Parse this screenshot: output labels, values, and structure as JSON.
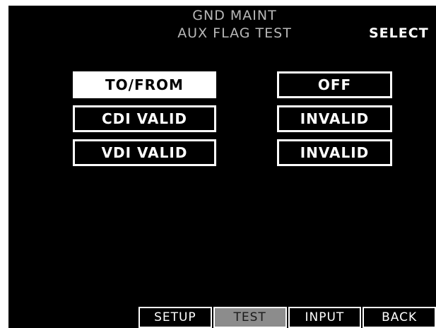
{
  "header": {
    "line1": "GND MAINT",
    "line2": "AUX FLAG TEST",
    "select_label": "SELECT"
  },
  "flags": [
    {
      "name": "TO/FROM",
      "value": "OFF",
      "selected": true
    },
    {
      "name": "CDI VALID",
      "value": "INVALID",
      "selected": false
    },
    {
      "name": "VDI VALID",
      "value": "INVALID",
      "selected": false
    }
  ],
  "softkeys": [
    {
      "label": "SETUP",
      "active": false
    },
    {
      "label": "TEST",
      "active": true
    },
    {
      "label": "INPUT",
      "active": false
    },
    {
      "label": "BACK",
      "active": false
    }
  ],
  "colors": {
    "background": "#000000",
    "foreground": "#ffffff",
    "header_text": "#b8b8b8",
    "active_softkey": "#8c8c8c"
  }
}
